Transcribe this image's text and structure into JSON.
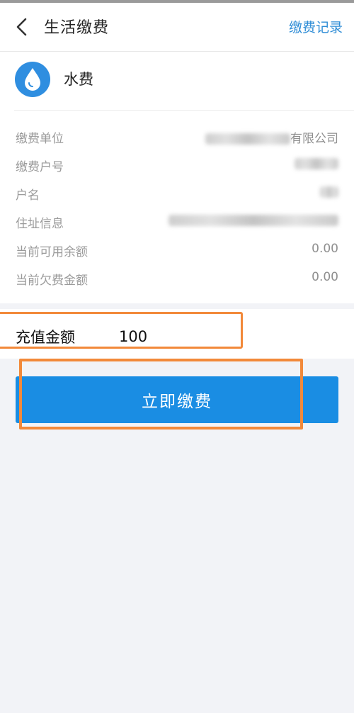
{
  "header": {
    "title": "生活缴费",
    "history_link": "缴费记录"
  },
  "fee": {
    "name": "水费",
    "icon": "water-drop-icon",
    "accent": "#2f8ee0"
  },
  "info": {
    "unit": {
      "label": "缴费单位",
      "value": "有限公司"
    },
    "account": {
      "label": "缴费户号"
    },
    "holder": {
      "label": "户名"
    },
    "address": {
      "label": "住址信息"
    },
    "balance": {
      "label": "当前可用余额",
      "value": "0.00"
    },
    "arrears": {
      "label": "当前欠费金额",
      "value": "0.00"
    }
  },
  "recharge": {
    "label": "充值金额",
    "value": "100"
  },
  "pay_button": {
    "label": "立即缴费",
    "color": "#1a8de3"
  },
  "highlight_color": "#f2893a"
}
